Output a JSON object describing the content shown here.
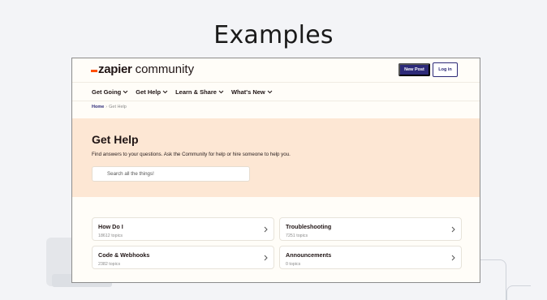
{
  "slide": {
    "title": "Examples"
  },
  "header": {
    "logo_zapier": "zapier",
    "logo_community": "community",
    "new_post_label": "New Post",
    "login_label": "Log in",
    "brand_color": "#ff4f00",
    "button_color": "#2d2a78"
  },
  "nav": {
    "items": [
      {
        "label": "Get Going"
      },
      {
        "label": "Get Help"
      },
      {
        "label": "Learn & Share"
      },
      {
        "label": "What's New"
      }
    ]
  },
  "breadcrumb": {
    "home": "Home",
    "separator": "›",
    "current": "Get Help"
  },
  "hero": {
    "title": "Get Help",
    "description": "Find answers to your questions. Ask the Community for help or hire someone to help you.",
    "search_placeholder": "Search all the things!",
    "background": "#fde7d4"
  },
  "categories": [
    {
      "title": "How Do I",
      "meta": "18612 topics"
    },
    {
      "title": "Troubleshooting",
      "meta": "7251 topics"
    },
    {
      "title": "Code & Webhooks",
      "meta": "2382 topics"
    },
    {
      "title": "Announcements",
      "meta": "0 topics"
    }
  ]
}
